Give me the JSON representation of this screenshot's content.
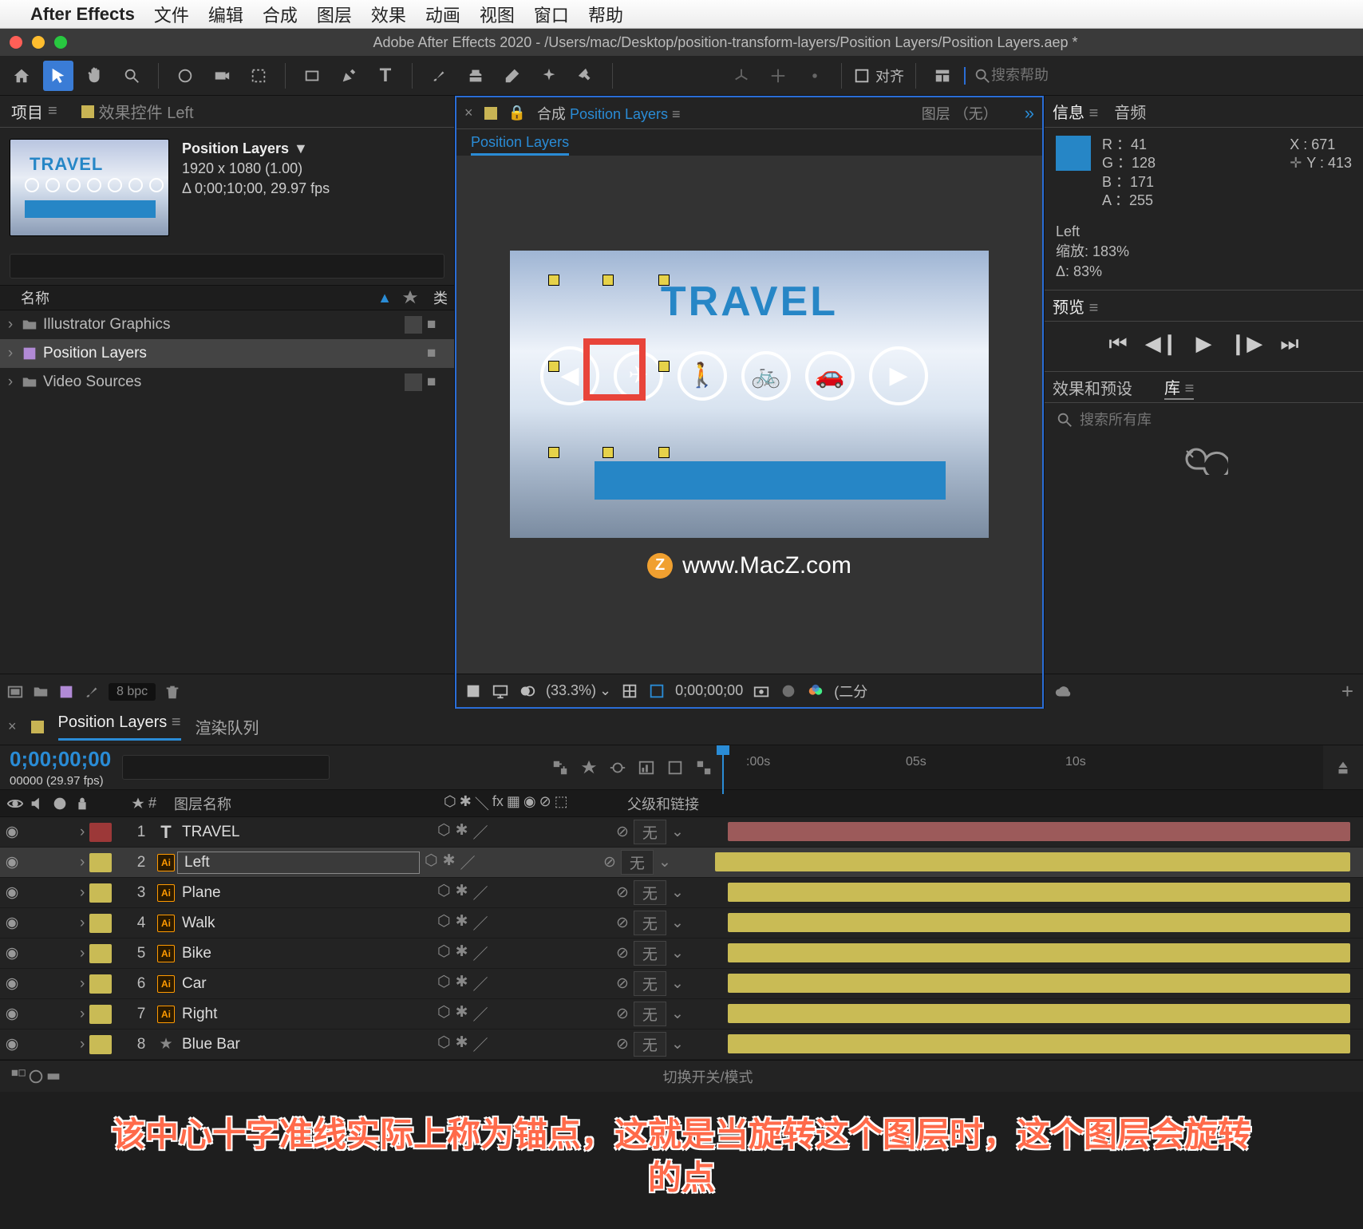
{
  "menubar": {
    "apple": "",
    "app": "After Effects",
    "items": [
      "文件",
      "编辑",
      "合成",
      "图层",
      "效果",
      "动画",
      "视图",
      "窗口",
      "帮助"
    ]
  },
  "titlebar": {
    "title": "Adobe After Effects 2020 - /Users/mac/Desktop/position-transform-layers/Position Layers/Position Layers.aep *"
  },
  "toolbar": {
    "align": "对齐",
    "search_placeholder": "搜索帮助"
  },
  "project": {
    "tab_project": "项目",
    "tab_effects": "效果控件 Left",
    "comp_name": "Position Layers",
    "arrow": "▼",
    "res": "1920 x 1080 (1.00)",
    "dur": "Δ 0;00;10;00, 29.97 fps",
    "search_placeholder": "",
    "col_name": "名称",
    "col_tag": "",
    "col_type": "类",
    "rows": [
      {
        "name": "Illustrator Graphics",
        "type": "folder"
      },
      {
        "name": "Position Layers",
        "type": "comp",
        "selected": true
      },
      {
        "name": "Video Sources",
        "type": "folder"
      }
    ],
    "bpc": "8 bpc"
  },
  "comp": {
    "tab_comp_prefix": "合成 ",
    "tab_comp_name": "Position Layers",
    "tab_layer": "图层 （无）",
    "breadcrumb": "Position Layers",
    "travel": "TRAVEL",
    "watermark": "www.MacZ.com",
    "zoom_pct": "(33.3%)",
    "timecode": "0;00;00;00",
    "resolution": "(二分"
  },
  "info": {
    "tab_info": "信息",
    "tab_audio": "音频",
    "r": "R ：41",
    "g": "G ：128",
    "b": "B ：171",
    "a": "A ：255",
    "x": "X : 671",
    "y": "Y : 413",
    "layer": "Left",
    "scale": "缩放: 183%",
    "delta": "Δ: 83%"
  },
  "preview": {
    "tab": "预览"
  },
  "effects": {
    "tab_fx": "效果和预设",
    "tab_lib": "库",
    "search_placeholder": "搜索所有库"
  },
  "timeline": {
    "tab1": "Position Layers",
    "tab2": "渲染队列",
    "timecode": "0;00;00;00",
    "subtime": "00000 (29.97 fps)",
    "search_placeholder": "",
    "ticks": [
      {
        "pos": 30,
        "label": ":00s"
      },
      {
        "pos": 230,
        "label": "05s"
      },
      {
        "pos": 430,
        "label": "10s"
      }
    ],
    "col_eye": "",
    "col_num": "#",
    "col_name": "图层名称",
    "col_parent": "父级和链接",
    "layers": [
      {
        "num": 1,
        "name": "TRAVEL",
        "icon": "T",
        "color": "#9c3838",
        "bar": "#9c5a5a"
      },
      {
        "num": 2,
        "name": "Left",
        "icon": "Ai",
        "color": "#c9bb55",
        "bar": "#c9bb55",
        "selected": true
      },
      {
        "num": 3,
        "name": "Plane",
        "icon": "Ai",
        "color": "#c9bb55",
        "bar": "#c9bb55"
      },
      {
        "num": 4,
        "name": "Walk",
        "icon": "Ai",
        "color": "#c9bb55",
        "bar": "#c9bb55"
      },
      {
        "num": 5,
        "name": "Bike",
        "icon": "Ai",
        "color": "#c9bb55",
        "bar": "#c9bb55"
      },
      {
        "num": 6,
        "name": "Car",
        "icon": "Ai",
        "color": "#c9bb55",
        "bar": "#c9bb55"
      },
      {
        "num": 7,
        "name": "Right",
        "icon": "Ai",
        "color": "#c9bb55",
        "bar": "#c9bb55"
      },
      {
        "num": 8,
        "name": "Blue Bar",
        "icon": "★",
        "color": "#c9bb55",
        "bar": "#c9bb55"
      }
    ],
    "parent_none": "无",
    "toggle_label": "切换开关/模式"
  },
  "caption": {
    "line1": "该中心十字准线实际上称为锚点，这就是当旋转这个图层时，这个图层会旋转",
    "line2": "的点"
  }
}
